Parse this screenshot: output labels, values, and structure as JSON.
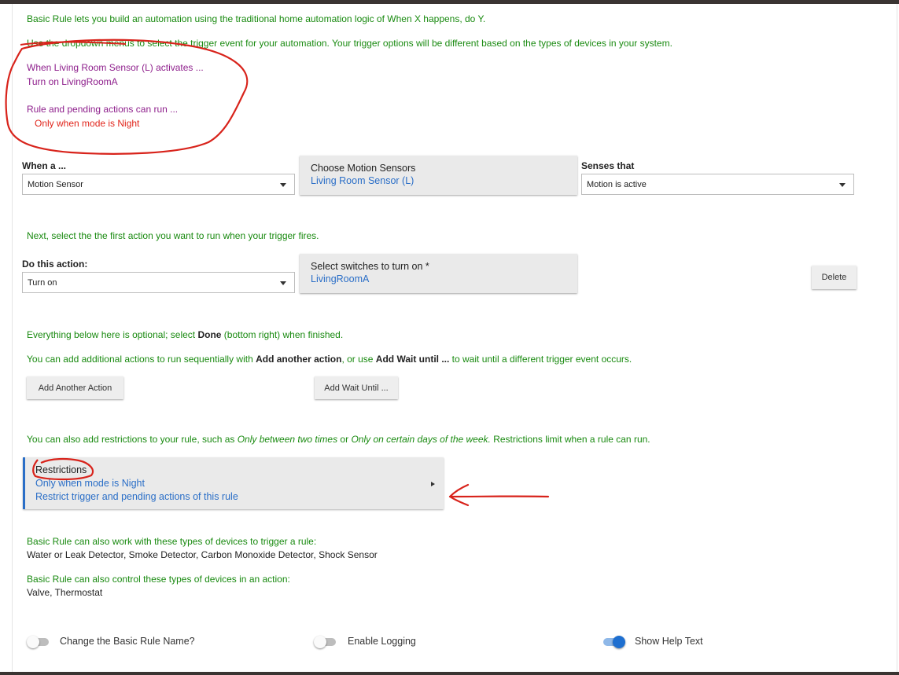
{
  "intro": {
    "line1": "Basic Rule lets you build an automation using the traditional home automation logic of When X happens, do Y.",
    "line2": "Use the dropdown menus to select the trigger event for your automation. Your trigger options will be different based on the types of devices in your system."
  },
  "summary": {
    "trigger": "When Living Room Sensor (L) activates ...",
    "action": "Turn on LivingRoomA",
    "condition_label": "Rule and pending actions can run ...",
    "condition_value": "Only when mode is Night"
  },
  "trigger": {
    "when_label": "When a ...",
    "device_type": "Motion Sensor",
    "choose_title": "Choose Motion Sensors",
    "choose_value": "Living Room Sensor (L)",
    "senses_label": "Senses that",
    "senses_value": "Motion is active"
  },
  "action": {
    "intro": "Next, select the the first action you want to run when your trigger fires.",
    "do_label": "Do this action:",
    "action_value": "Turn on",
    "select_title": "Select switches to turn on *",
    "select_value": "LivingRoomA",
    "delete_label": "Delete"
  },
  "optional": {
    "p1_pre": "Everything below here is optional; select ",
    "p1_bold": "Done",
    "p1_post": " (bottom right) when finished.",
    "p2_pre": "You can add additional actions to run sequentially with ",
    "p2_bold1": "Add another action",
    "p2_mid": ", or use ",
    "p2_bold2": "Add Wait until ...",
    "p2_post": " to wait until a different trigger event occurs.",
    "add_action_label": "Add Another Action",
    "add_wait_label": "Add Wait Until ..."
  },
  "restrictions": {
    "intro_pre": "You can also add restrictions to your rule, such as ",
    "intro_i1": "Only between two times",
    "intro_mid": " or ",
    "intro_i2": "Only on certain days of the week.",
    "intro_post": "  Restrictions limit when a rule can run.",
    "title": "Restrictions",
    "line1": "Only when mode is Night",
    "line2": "Restrict trigger and pending actions of this rule"
  },
  "devices": {
    "trigger_title": "Basic Rule can also work with these types of devices to trigger a rule:",
    "trigger_list": "Water or Leak Detector, Smoke Detector, Carbon Monoxide Detector, Shock Sensor",
    "control_title": "Basic Rule can also control these types of devices in an action:",
    "control_list": "Valve, Thermostat"
  },
  "toggles": {
    "rename": {
      "label": "Change the Basic Rule Name?",
      "on": false
    },
    "logging": {
      "label": "Enable Logging",
      "on": false
    },
    "help": {
      "label": "Show Help Text",
      "on": true
    }
  },
  "colors": {
    "help_text": "#198a10",
    "summary_text": "#8e1f8c",
    "condition_text": "#e1251b",
    "link_text": "#2a6ec7",
    "annotation": "#d8231b"
  }
}
